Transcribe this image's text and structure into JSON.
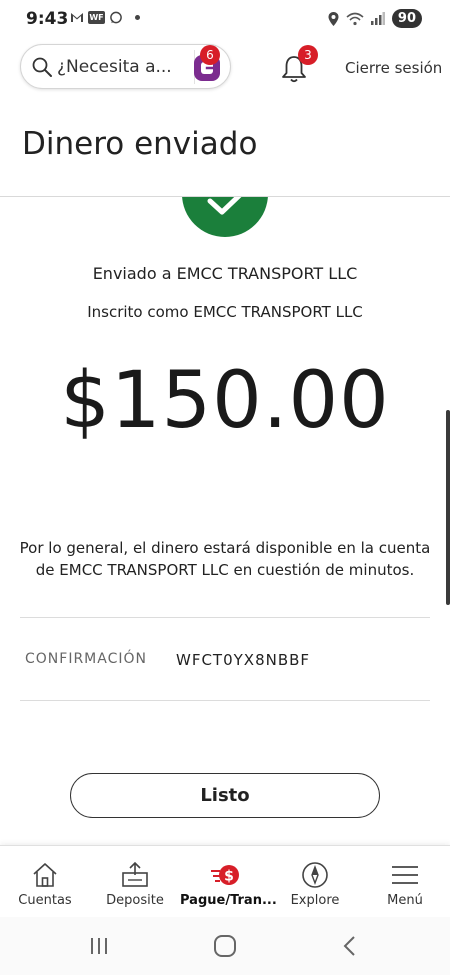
{
  "status_bar": {
    "time": "9:43",
    "battery": "90",
    "icons_left": [
      "gmail-icon",
      "wf-app-icon",
      "whatsapp-icon",
      "dot-icon"
    ],
    "icons_right": [
      "location-icon",
      "wifi-icon",
      "signal-icon",
      "battery-icon"
    ]
  },
  "header": {
    "search_placeholder": "¿Necesita a...",
    "assistant_badge": "6",
    "notifications_badge": "3",
    "logout_label": "Cierre sesión"
  },
  "page": {
    "title": "Dinero enviado"
  },
  "transfer": {
    "sent_to": "Enviado a EMCC TRANSPORT LLC",
    "enrolled_as": "Inscrito como EMCC TRANSPORT LLC",
    "amount": "$150.00",
    "availability": "Por lo general, el dinero estará disponible en la cuenta de EMCC TRANSPORT LLC en cuestión de minutos.",
    "confirmation_label": "CONFIRMACIÓN",
    "confirmation_value": "WFCT0YX8NBBF",
    "done_label": "Listo"
  },
  "bottom_nav": {
    "items": [
      {
        "label": "Cuentas",
        "icon": "house-icon"
      },
      {
        "label": "Deposite",
        "icon": "deposit-icon"
      },
      {
        "label": "Pague/Tran...",
        "icon": "pay-transfer-icon",
        "active": true
      },
      {
        "label": "Explore",
        "icon": "compass-icon"
      },
      {
        "label": "Menú",
        "icon": "menu-icon"
      }
    ]
  },
  "colors": {
    "brand_red": "#d71e28",
    "success_green": "#1b7f3b",
    "assistant_purple": "#7b2b8f"
  }
}
